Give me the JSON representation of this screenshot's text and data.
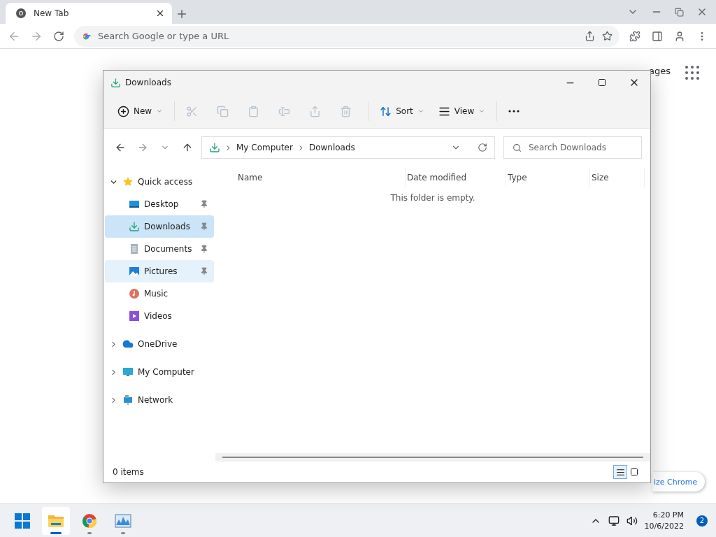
{
  "browser": {
    "tab": {
      "title": "New Tab"
    },
    "address": {
      "placeholder": "Search Google or type a URL"
    },
    "page": {
      "top_link": "ages",
      "customize_button": "ize Chrome"
    }
  },
  "explorer": {
    "title": "Downloads",
    "commands": [
      {
        "kind": "new",
        "label": "New",
        "disabled": false
      },
      {
        "kind": "cut",
        "disabled": true
      },
      {
        "kind": "copy",
        "disabled": true
      },
      {
        "kind": "paste",
        "disabled": true
      },
      {
        "kind": "rename",
        "disabled": true
      },
      {
        "kind": "share",
        "disabled": true
      },
      {
        "kind": "delete",
        "disabled": true
      },
      {
        "kind": "sort",
        "label": "Sort",
        "disabled": false
      },
      {
        "kind": "view",
        "label": "View",
        "disabled": false
      },
      {
        "kind": "more",
        "disabled": false
      }
    ],
    "breadcrumb": [
      "My Computer",
      "Downloads"
    ],
    "search": {
      "placeholder": "Search Downloads"
    },
    "tree": [
      {
        "kind": "star",
        "label": "Quick access",
        "expanded": true,
        "selected": false,
        "hovered": false,
        "children": [
          {
            "kind": "desktop",
            "label": "Desktop",
            "pinned": true,
            "selected": false,
            "hovered": false
          },
          {
            "kind": "downloads",
            "label": "Downloads",
            "pinned": true,
            "selected": true,
            "hovered": false
          },
          {
            "kind": "documents",
            "label": "Documents",
            "pinned": true,
            "selected": false,
            "hovered": false
          },
          {
            "kind": "pictures",
            "label": "Pictures",
            "pinned": true,
            "selected": false,
            "hovered": true
          },
          {
            "kind": "music",
            "label": "Music",
            "pinned": false,
            "selected": false,
            "hovered": false
          },
          {
            "kind": "videos",
            "label": "Videos",
            "pinned": false,
            "selected": false,
            "hovered": false
          }
        ]
      },
      {
        "kind": "cloud",
        "label": "OneDrive",
        "expanded": false,
        "selected": false,
        "hovered": false
      },
      {
        "kind": "computer",
        "label": "My Computer",
        "expanded": false,
        "selected": false,
        "hovered": false
      },
      {
        "kind": "network",
        "label": "Network",
        "expanded": false,
        "selected": false,
        "hovered": false
      }
    ],
    "columns": [
      "Name",
      "Date modified",
      "Type",
      "Size"
    ],
    "empty_message": "This folder is empty.",
    "status": "0 items",
    "views": [
      {
        "kind": "details",
        "selected": true
      },
      {
        "kind": "tiles",
        "selected": false
      }
    ]
  },
  "taskbar": {
    "apps": [
      {
        "kind": "start",
        "active": false,
        "running": false
      },
      {
        "kind": "files",
        "active": true,
        "running": true
      },
      {
        "kind": "chrome",
        "active": false,
        "running": true
      },
      {
        "kind": "monitor",
        "active": false,
        "running": true
      }
    ],
    "time": "6:20 PM",
    "date": "10/6/2022",
    "notifications": "2"
  }
}
